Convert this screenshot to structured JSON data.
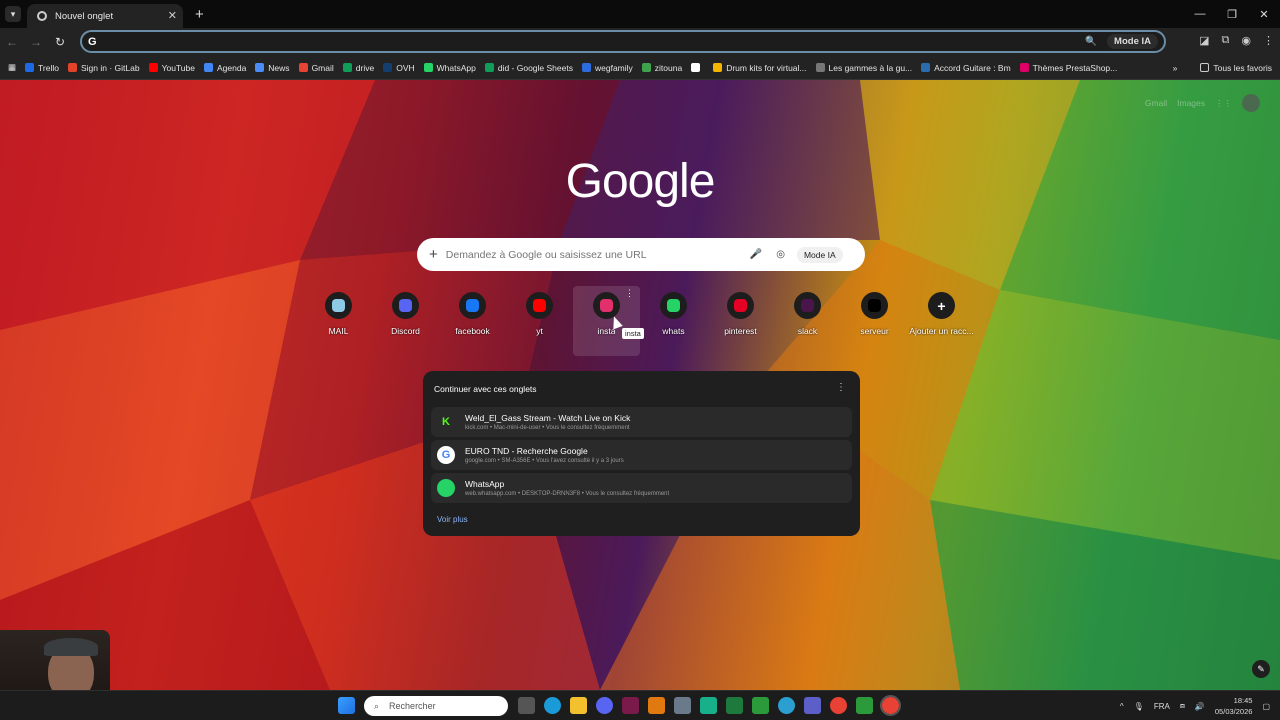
{
  "browser": {
    "tab_title": "Nouvel onglet",
    "omnibox_value": "",
    "omnibox_ai_button": "Mode IA"
  },
  "bookmarks": [
    {
      "label": "Trello",
      "color": "#1d6ae5"
    },
    {
      "label": "Sign in · GitLab",
      "color": "#e24329"
    },
    {
      "label": "YouTube",
      "color": "#ff0000"
    },
    {
      "label": "Agenda",
      "color": "#4285f4"
    },
    {
      "label": "News",
      "color": "#4c8bf5"
    },
    {
      "label": "Gmail",
      "color": "#ea4335"
    },
    {
      "label": "drive",
      "color": "#0f9d58"
    },
    {
      "label": "OVH",
      "color": "#123f6d"
    },
    {
      "label": "WhatsApp",
      "color": "#25d366"
    },
    {
      "label": "did - Google Sheets",
      "color": "#0f9d58"
    },
    {
      "label": "wegfamily",
      "color": "#2d6cdf"
    },
    {
      "label": "zitouna",
      "color": "#3fa34d"
    },
    {
      "label": "",
      "color": "#ffffff"
    },
    {
      "label": "Drum kits for virtual...",
      "color": "#f4b400"
    },
    {
      "label": "Les gammes à la gu...",
      "color": "#777777"
    },
    {
      "label": "Accord Guitare : Bm",
      "color": "#2b6cb0"
    },
    {
      "label": "Thèmes PrestaShop...",
      "color": "#df0067"
    }
  ],
  "bookmarks_all": "Tous les favoris",
  "top_links": {
    "gmail": "Gmail",
    "images": "Images"
  },
  "search": {
    "placeholder": "Demandez à Google ou saisissez une URL",
    "ai_mode": "Mode IA"
  },
  "logo_text": "Google",
  "shortcuts": [
    {
      "label": "MAIL",
      "icon": "mail-icon",
      "color": "#8ecae6"
    },
    {
      "label": "Discord",
      "icon": "discord-icon",
      "color": "#5865f2"
    },
    {
      "label": "facebook",
      "icon": "facebook-icon",
      "color": "#1877f2"
    },
    {
      "label": "yt",
      "icon": "youtube-icon",
      "color": "#ff0000"
    },
    {
      "label": "insta",
      "icon": "instagram-icon",
      "color": "#e1306c"
    },
    {
      "label": "whats",
      "icon": "whatsapp-icon",
      "color": "#25d366"
    },
    {
      "label": "pinterest",
      "icon": "pinterest-icon",
      "color": "#e60023"
    },
    {
      "label": "slack",
      "icon": "slack-icon",
      "color": "#4a154b"
    },
    {
      "label": "serveur",
      "icon": "tiktok-icon",
      "color": "#000000"
    },
    {
      "label": "Ajouter un racc...",
      "icon": "plus-icon",
      "color": "#3c3c3c"
    }
  ],
  "tooltip": "insta",
  "continue_panel": {
    "title": "Continuer avec ces onglets",
    "rows": [
      {
        "title": "Weld_El_Gass Stream - Watch Live on Kick",
        "meta": "kick.com • Mac-mini-de-user • Vous le consultez fréquemment",
        "icon": "kick-icon",
        "color": "#53fc18"
      },
      {
        "title": "EURO TND - Recherche Google",
        "meta": "google.com • SM-A356E • Vous l'avez consulté il y a 3 jours",
        "icon": "google-icon",
        "color": "#ffffff"
      },
      {
        "title": "WhatsApp",
        "meta": "web.whatsapp.com • DESKTOP-DRNN3F8 • Vous le consultez fréquemment",
        "icon": "whatsapp-icon",
        "color": "#25d366"
      }
    ],
    "more": "Voir plus"
  },
  "taskbar": {
    "search_label": "Rechercher",
    "lang": "FRA",
    "time": "18:45",
    "date": "05/03/2026"
  }
}
